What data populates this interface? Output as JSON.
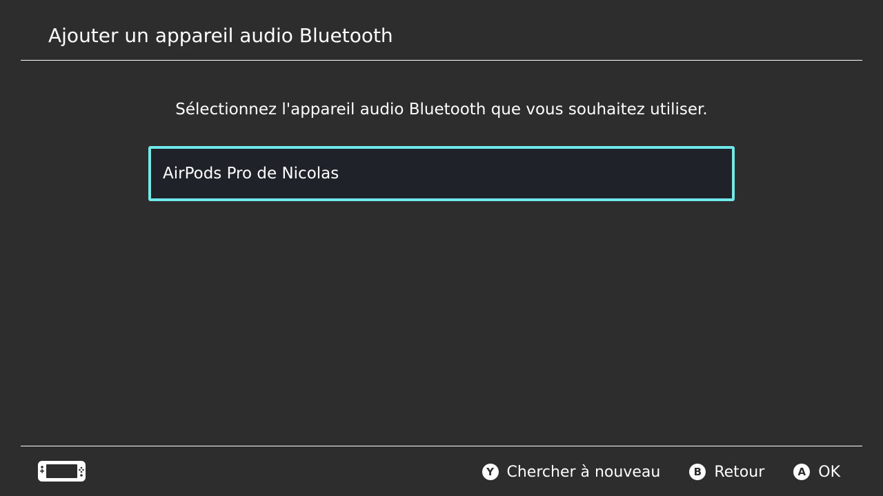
{
  "header": {
    "title": "Ajouter un appareil audio Bluetooth"
  },
  "main": {
    "instruction": "Sélectionnez l'appareil audio Bluetooth que vous souhaitez utiliser.",
    "devices": [
      {
        "name": "AirPods Pro de Nicolas",
        "selected": true
      }
    ]
  },
  "footer": {
    "console_icon": "handheld-console-icon",
    "actions": [
      {
        "button": "Y",
        "icon": "y-button-icon",
        "label": "Chercher à nouveau"
      },
      {
        "button": "B",
        "icon": "b-button-icon",
        "label": "Retour"
      },
      {
        "button": "A",
        "icon": "a-button-icon",
        "label": "OK"
      }
    ]
  },
  "colors": {
    "background": "#2d2d2d",
    "selection_border": "#6fe9ea",
    "item_background": "#1f2329",
    "text": "#ffffff"
  }
}
